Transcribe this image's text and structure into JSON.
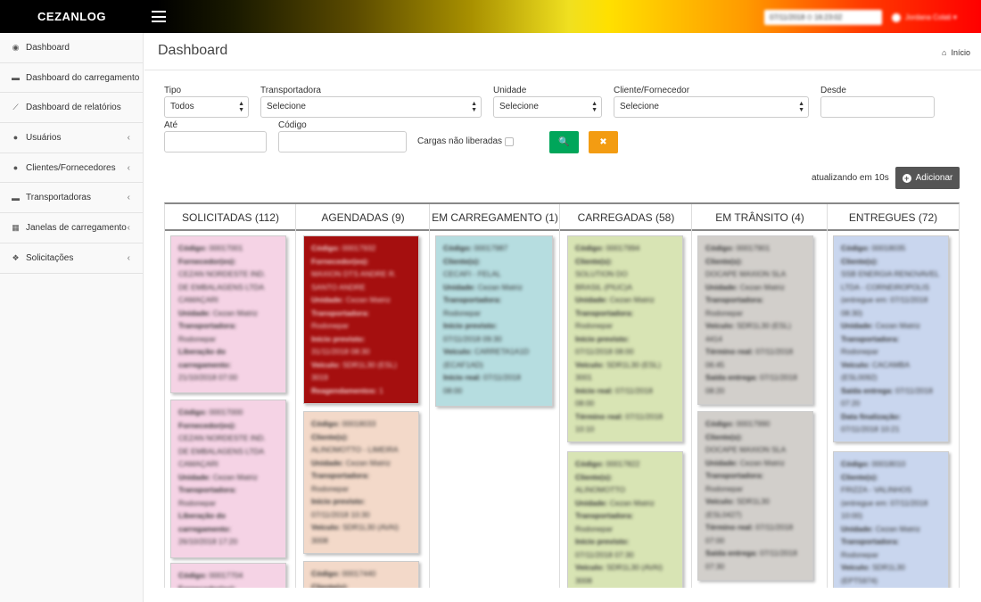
{
  "app": {
    "brand": "CEZANLOG",
    "date_text": "07/11/2018 ⏲ 16:23:02",
    "user_name": "Jordana Colati"
  },
  "colors": {
    "green": "#00a65a",
    "orange": "#f39c12",
    "dark": "#555555"
  },
  "sidebar": {
    "items": [
      {
        "label": "Dashboard",
        "icon": "dashboard-icon",
        "glyph": "◉",
        "chevron": false
      },
      {
        "label": "Dashboard do carregamento",
        "icon": "truck-icon",
        "glyph": "▬",
        "chevron": false
      },
      {
        "label": "Dashboard de relatórios",
        "icon": "line-chart-icon",
        "glyph": "⟋",
        "chevron": false
      },
      {
        "label": "Usuários",
        "icon": "users-icon",
        "glyph": "●",
        "chevron": true
      },
      {
        "label": "Clientes/Fornecedores",
        "icon": "users-icon",
        "glyph": "●",
        "chevron": true
      },
      {
        "label": "Transportadoras",
        "icon": "truck-icon",
        "glyph": "▬",
        "chevron": true
      },
      {
        "label": "Janelas de carregamento",
        "icon": "table-icon",
        "glyph": "▦",
        "chevron": true
      },
      {
        "label": "Solicitações",
        "icon": "cubes-icon",
        "glyph": "❖",
        "chevron": true
      }
    ]
  },
  "header": {
    "title": "Dashboard",
    "breadcrumb": "Início"
  },
  "filters": {
    "tipo": {
      "label": "Tipo",
      "value": "Todos"
    },
    "transportadora": {
      "label": "Transportadora",
      "value": "Selecione"
    },
    "unidade": {
      "label": "Unidade",
      "value": "Selecione"
    },
    "cliente": {
      "label": "Cliente/Fornecedor",
      "value": "Selecione"
    },
    "desde": {
      "label": "Desde",
      "value": ""
    },
    "ate": {
      "label": "Até",
      "value": ""
    },
    "codigo": {
      "label": "Código",
      "value": ""
    },
    "cargas": {
      "label": "Cargas não liberadas"
    }
  },
  "actions": {
    "search_glyph": "🔍",
    "clear_glyph": "✖",
    "updating": "atualizando em 10s",
    "add_label": "Adicionar"
  },
  "board": {
    "columns": [
      {
        "title": "SOLICITADAS (112)",
        "cards": [
          {
            "bg": "#f5d3e5",
            "fg": "#333",
            "lines": [
              [
                "Código:",
                "00017001"
              ],
              [
                "Fornecedor(es):",
                ""
              ],
              [
                "",
                "CEZAN NORDESTE IND."
              ],
              [
                "",
                "DE EMBALAGENS LTDA"
              ],
              [
                "",
                "CAMAÇARI"
              ],
              [
                "Unidade:",
                "Cezan Matriz"
              ],
              [
                "Transportadora:",
                ""
              ],
              [
                "",
                "Rodonepar"
              ],
              [
                "Liberação do",
                ""
              ],
              [
                "carregamento:",
                ""
              ],
              [
                "",
                "21/10/2018 07:00"
              ]
            ]
          },
          {
            "bg": "#f5d3e5",
            "fg": "#333",
            "lines": [
              [
                "Código:",
                "00017000"
              ],
              [
                "Fornecedor(es):",
                ""
              ],
              [
                "",
                "CEZAN NORDESTE IND."
              ],
              [
                "",
                "DE EMBALAGENS LTDA"
              ],
              [
                "",
                "CAMAÇARI"
              ],
              [
                "Unidade:",
                "Cezan Matriz"
              ],
              [
                "Transportadora:",
                ""
              ],
              [
                "",
                "Rodonepar"
              ],
              [
                "Liberação do",
                ""
              ],
              [
                "carregamento:",
                ""
              ],
              [
                "",
                "26/10/2018 17:20"
              ]
            ]
          },
          {
            "bg": "#f5d3e5",
            "fg": "#333",
            "lines": [
              [
                "Código:",
                "00017704"
              ],
              [
                "Fornecedor(es):",
                ""
              ]
            ]
          }
        ]
      },
      {
        "title": "AGENDADAS (9)",
        "cards": [
          {
            "bg": "#a50f0f",
            "fg": "#f3d4d4",
            "lines": [
              [
                "Código:",
                "00017932"
              ],
              [
                "Fornecedor(es):",
                ""
              ],
              [
                "",
                "MAXION DTS ANDRE R."
              ],
              [
                "",
                "SANTO ANDRE"
              ],
              [
                "Unidade:",
                "Cezan Matriz"
              ],
              [
                "Transportadora:",
                ""
              ],
              [
                "",
                "Rodonepar"
              ],
              [
                "Início previsto:",
                ""
              ],
              [
                "",
                "31/11/2018 08:30"
              ],
              [
                "Veículo:",
                "SDR1L30 (ESL)"
              ],
              [
                "",
                "3019"
              ],
              [
                "Reagendamentos:",
                "1"
              ]
            ]
          },
          {
            "bg": "#f3d9c9",
            "fg": "#333",
            "lines": [
              [
                "Código:",
                "00018033"
              ],
              [
                "Cliente(s):",
                ""
              ],
              [
                "",
                "ALINOMOTTO - LIMEIRA"
              ],
              [
                "Unidade:",
                "Cezan Matriz"
              ],
              [
                "Transportadora:",
                ""
              ],
              [
                "",
                "Rodonepar"
              ],
              [
                "Início previsto:",
                ""
              ],
              [
                "",
                "07/11/2018 10:30"
              ],
              [
                "Veículo:",
                "SDR1L30 (AVAI)"
              ],
              [
                "",
                "3008"
              ]
            ]
          },
          {
            "bg": "#f3d9c9",
            "fg": "#333",
            "lines": [
              [
                "Código:",
                "00017440"
              ],
              [
                "Cliente(s):",
                ""
              ]
            ]
          }
        ]
      },
      {
        "title": "EM CARREGAMENTO (1)",
        "cards": [
          {
            "bg": "#b6dde0",
            "fg": "#333",
            "lines": [
              [
                "Código:",
                "00017987"
              ],
              [
                "Cliente(s):",
                ""
              ],
              [
                "",
                "CECAFI - FELAL"
              ],
              [
                "Unidade:",
                "Cezan Matriz"
              ],
              [
                "Transportadora:",
                ""
              ],
              [
                "",
                "Rodonepar"
              ],
              [
                "Início previsto:",
                ""
              ],
              [
                "",
                "07/11/2018 09:30"
              ],
              [
                "Veículo:",
                "CARRETA1A1D"
              ],
              [
                "",
                "(ECAF1AD)"
              ],
              [
                "Início real:",
                "07/11/2018"
              ],
              [
                "",
                "08:00"
              ]
            ]
          }
        ]
      },
      {
        "title": "CARREGADAS (58)",
        "cards": [
          {
            "bg": "#d8e4b4",
            "fg": "#333",
            "lines": [
              [
                "Código:",
                "00017994"
              ],
              [
                "Cliente(s):",
                ""
              ],
              [
                "",
                "SOLUTION DO"
              ],
              [
                "",
                "BRASIL (PIUC)A"
              ],
              [
                "Unidade:",
                "Cezan Matriz"
              ],
              [
                "Transportadora:",
                ""
              ],
              [
                "",
                "Rodonepar"
              ],
              [
                "Início previsto:",
                ""
              ],
              [
                "",
                "07/11/2018 08:00"
              ],
              [
                "Veículo:",
                "SDR1L30 (ESL)"
              ],
              [
                "",
                "3001"
              ],
              [
                "Início real:",
                "07/11/2018"
              ],
              [
                "",
                "08:00"
              ],
              [
                "Término real:",
                "07/11/2018"
              ],
              [
                "",
                "10:10"
              ]
            ]
          },
          {
            "bg": "#d8e4b4",
            "fg": "#333",
            "lines": [
              [
                "Código:",
                "00017822"
              ],
              [
                "Cliente(s):",
                ""
              ],
              [
                "",
                "ALINOMOTTO"
              ],
              [
                "Unidade:",
                "Cezan Matriz"
              ],
              [
                "Transportadora:",
                ""
              ],
              [
                "",
                "Rodonepar"
              ],
              [
                "Início previsto:",
                ""
              ],
              [
                "",
                "07/11/2018 07:30"
              ],
              [
                "Veículo:",
                "SDR1L30 (AVAI)"
              ],
              [
                "",
                "3008"
              ]
            ]
          }
        ]
      },
      {
        "title": "EM TRÂNSITO (4)",
        "cards": [
          {
            "bg": "#d2cfcb",
            "fg": "#333",
            "lines": [
              [
                "Código:",
                "00017901"
              ],
              [
                "Cliente(s):",
                ""
              ],
              [
                "",
                "DOCAPE MAXION SLA"
              ],
              [
                "Unidade:",
                "Cezan Matriz"
              ],
              [
                "Transportadora:",
                ""
              ],
              [
                "",
                "Rodonepar"
              ],
              [
                "Veículo:",
                "SDR1L30 (ESL)"
              ],
              [
                "",
                "4414"
              ],
              [
                "Término real:",
                "07/11/2018"
              ],
              [
                "",
                "06:45"
              ],
              [
                "Saída entrega:",
                "07/11/2018"
              ],
              [
                "",
                "08:20"
              ]
            ]
          },
          {
            "bg": "#d2cfcb",
            "fg": "#333",
            "lines": [
              [
                "Código:",
                "00017990"
              ],
              [
                "Cliente(s):",
                ""
              ],
              [
                "",
                "DOCAPE MAXION SLA"
              ],
              [
                "Unidade:",
                "Cezan Matriz"
              ],
              [
                "Transportadora:",
                ""
              ],
              [
                "",
                "Rodonepar"
              ],
              [
                "Veículo:",
                "SDR1L30"
              ],
              [
                "",
                "(ESL0427)"
              ],
              [
                "Término real:",
                "07/11/2018"
              ],
              [
                "",
                "07:00"
              ],
              [
                "Saída entrega:",
                "07/11/2018"
              ],
              [
                "",
                "07:30"
              ]
            ]
          }
        ]
      },
      {
        "title": "ENTREGUES (72)",
        "cards": [
          {
            "bg": "#c9d6ee",
            "fg": "#333",
            "lines": [
              [
                "Código:",
                "00018035"
              ],
              [
                "Cliente(s):",
                ""
              ],
              [
                "",
                "SSB ENERGIA RENOVAVEL"
              ],
              [
                "",
                "LTDA - CORNEIROPOLIS"
              ],
              [
                "",
                "(entregue em: 07/11/2018"
              ],
              [
                "",
                "08:30)"
              ],
              [
                "Unidade:",
                "Cezan Matriz"
              ],
              [
                "Transportadora:",
                ""
              ],
              [
                "",
                "Rodonepar"
              ],
              [
                "Veículo:",
                "CACAMBA"
              ],
              [
                "",
                "(ESL0092)"
              ],
              [
                "Saída entrega:",
                "07/11/2018"
              ],
              [
                "",
                "07:20"
              ],
              [
                "Data finalização:",
                ""
              ],
              [
                "",
                "07/11/2018 10:21"
              ]
            ]
          },
          {
            "bg": "#c9d6ee",
            "fg": "#333",
            "lines": [
              [
                "Código:",
                "00018010"
              ],
              [
                "Cliente(s):",
                ""
              ],
              [
                "",
                "FRIZZA - VALINHOS"
              ],
              [
                "",
                "(entregue em: 07/11/2018"
              ],
              [
                "",
                "10:00)"
              ],
              [
                "Unidade:",
                "Cezan Matriz"
              ],
              [
                "Transportadora:",
                ""
              ],
              [
                "",
                "Rodonepar"
              ],
              [
                "Veículo:",
                "SDR1L30"
              ],
              [
                "",
                "(EPT5974)"
              ]
            ]
          }
        ]
      }
    ]
  }
}
